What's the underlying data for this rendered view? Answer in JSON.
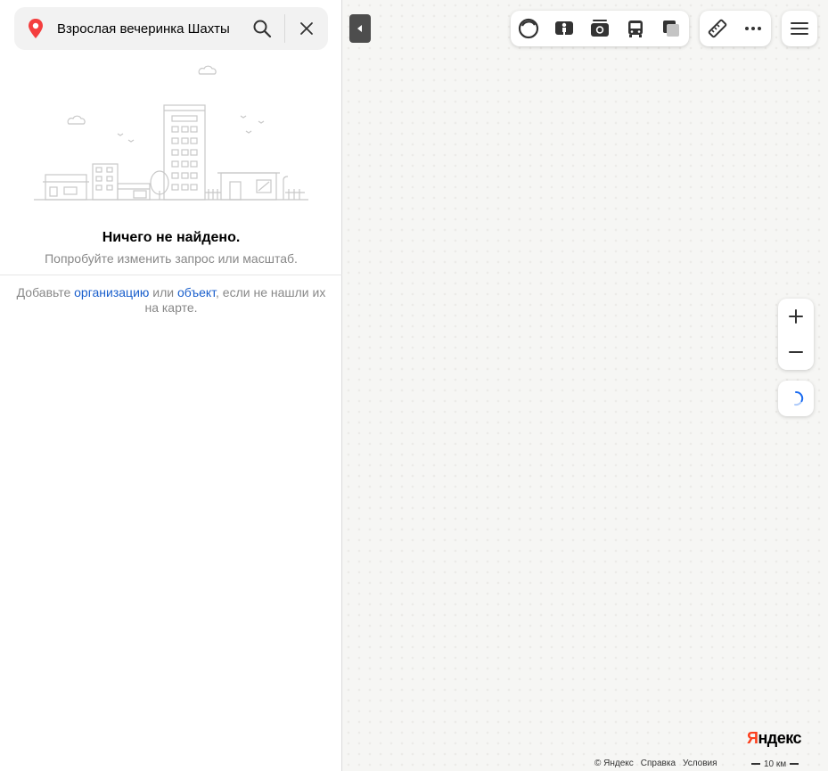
{
  "search": {
    "value": "Взрослая вечеринка Шахты",
    "pin_icon": "location-pin-icon",
    "search_icon": "search-icon",
    "clear_icon": "close-icon"
  },
  "results": {
    "empty_title": "Ничего не найдено.",
    "empty_subtitle": "Попробуйте изменить запрос или масштаб.",
    "add_prefix": "Добавьте ",
    "add_org_link": "организацию",
    "add_middle": " или ",
    "add_object_link": "объект",
    "add_suffix": ", если не нашли их на карте."
  },
  "map": {
    "layers": [
      "traffic-icon",
      "panorama-icon",
      "photo-icon",
      "transit-icon",
      "layers-icon"
    ],
    "tools": [
      "ruler-icon",
      "more-icon"
    ],
    "menu_icon": "menu-icon",
    "zoom_in_icon": "plus-icon",
    "zoom_out_icon": "minus-icon",
    "geolocation_icon": "loading-spinner-icon",
    "logo_first": "Я",
    "logo_rest": "ндекс",
    "copyright": "© Яндекс",
    "help_link": "Справка",
    "terms_link": "Условия",
    "scale_label": "10 км"
  },
  "colors": {
    "accent_red": "#fc3f1d",
    "link_blue": "#1a5fcc",
    "pin_red": "#f43e3e",
    "spinner_blue": "#1a6bf0"
  }
}
